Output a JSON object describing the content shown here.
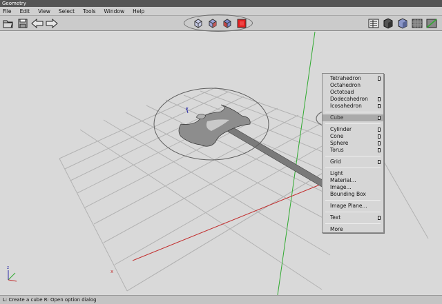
{
  "window": {
    "title": "Geometry"
  },
  "menubar": {
    "items": [
      "File",
      "Edit",
      "View",
      "Select",
      "Tools",
      "Window",
      "Help"
    ]
  },
  "toolbar": {
    "left_icons": [
      "folder-open-icon",
      "save-icon",
      "arrow-left-icon",
      "arrow-right-icon"
    ],
    "center_icons": [
      "cube-wire-icon",
      "cube-shaded-icon",
      "cube-textured-icon",
      "cube-solid-red-icon"
    ],
    "right_icons": [
      "layout-icon",
      "shade-dark-icon",
      "shade-blue-icon",
      "texture-icon",
      "ramp-icon"
    ],
    "colors": {
      "accent_red": "#e02020",
      "cube_blue": "#7a86c8"
    }
  },
  "viewport": {
    "z_axis_label": "z",
    "x_axis_label": "x",
    "colors": {
      "grid": "#b2b2b2",
      "y_axis": "#2faa2f",
      "x_axis": "#c23030",
      "z_axis": "#2d2da8"
    }
  },
  "context_menu": {
    "groups": [
      [
        {
          "label": "Tetrahedron",
          "opt": true
        },
        {
          "label": "Octahedron",
          "opt": false
        },
        {
          "label": "Octotoad",
          "opt": false
        },
        {
          "label": "Dodecahedron",
          "opt": true
        },
        {
          "label": "Icosahedron",
          "opt": true
        }
      ],
      [
        {
          "label": "Cube",
          "opt": true,
          "highlight": true
        }
      ],
      [
        {
          "label": "Cylinder",
          "opt": true
        },
        {
          "label": "Cone",
          "opt": true
        },
        {
          "label": "Sphere",
          "opt": true
        },
        {
          "label": "Torus",
          "opt": true
        }
      ],
      [
        {
          "label": "Grid",
          "opt": true
        }
      ],
      [
        {
          "label": "Light",
          "opt": false
        },
        {
          "label": "Material...",
          "opt": false
        },
        {
          "label": "Image...",
          "opt": false
        },
        {
          "label": "Bounding Box",
          "opt": false
        }
      ],
      [
        {
          "label": "Image Plane...",
          "opt": false
        }
      ],
      [
        {
          "label": "Text",
          "opt": true
        }
      ],
      [
        {
          "label": "More",
          "opt": false
        }
      ]
    ]
  },
  "statusbar": {
    "text": "L: Create a cube   R: Open option dialog"
  }
}
